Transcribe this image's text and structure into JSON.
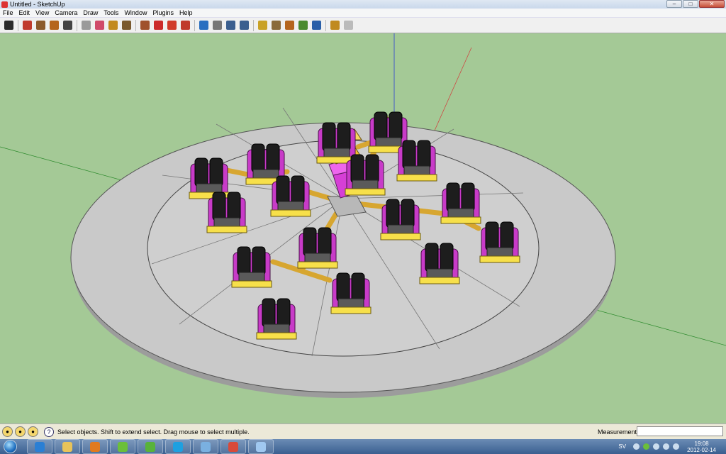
{
  "window": {
    "title": "Untitled - SketchUp"
  },
  "menu": [
    "File",
    "Edit",
    "View",
    "Camera",
    "Draw",
    "Tools",
    "Window",
    "Plugins",
    "Help"
  ],
  "window_controls": [
    "minimize",
    "maximize",
    "close"
  ],
  "toolbar": [
    {
      "name": "select-tool",
      "icon": "arrow-cursor-icon",
      "color": "#2a2a2a"
    },
    {
      "sep": true
    },
    {
      "name": "line-tool",
      "icon": "pencil-icon",
      "color": "#c0392b"
    },
    {
      "name": "rectangle-tool",
      "icon": "rectangle-icon",
      "color": "#8b5a2b"
    },
    {
      "name": "circle-tool",
      "icon": "circle-icon",
      "color": "#b5651d"
    },
    {
      "name": "arc-tool",
      "icon": "arc-icon",
      "color": "#444444"
    },
    {
      "sep": true
    },
    {
      "name": "make-component-tool",
      "icon": "component-icon",
      "color": "#9a9a9a"
    },
    {
      "name": "eraser-tool",
      "icon": "eraser-icon",
      "color": "#d04a6a"
    },
    {
      "name": "tape-measure-tool",
      "icon": "tape-measure-icon",
      "color": "#c28a1e"
    },
    {
      "name": "paint-bucket-tool",
      "icon": "paint-bucket-icon",
      "color": "#7a5a2e"
    },
    {
      "sep": true
    },
    {
      "name": "push-pull-tool",
      "icon": "push-pull-icon",
      "color": "#a0522d"
    },
    {
      "name": "move-tool",
      "icon": "move-icon",
      "color": "#cc2a2a"
    },
    {
      "name": "rotate-tool",
      "icon": "rotate-icon",
      "color": "#d03a2a"
    },
    {
      "name": "follow-me-tool",
      "icon": "follow-me-icon",
      "color": "#c0392b"
    },
    {
      "sep": true
    },
    {
      "name": "orbit-tool",
      "icon": "orbit-icon",
      "color": "#2a6fc0"
    },
    {
      "name": "pan-tool",
      "icon": "hand-icon",
      "color": "#777777"
    },
    {
      "name": "zoom-tool",
      "icon": "magnifier-icon",
      "color": "#3b5f8f"
    },
    {
      "name": "zoom-extents-tool",
      "icon": "zoom-extents-icon",
      "color": "#3b5f8f"
    },
    {
      "sep": true
    },
    {
      "name": "get-models-tool",
      "icon": "get-models-icon",
      "color": "#c9a227"
    },
    {
      "name": "share-model-tool",
      "icon": "share-model-icon",
      "color": "#8a6a3a"
    },
    {
      "name": "share-component-tool",
      "icon": "share-component-icon",
      "color": "#b5651d"
    },
    {
      "name": "place-model-tool",
      "icon": "place-model-icon",
      "color": "#4a8a2e"
    },
    {
      "name": "google-earth-tool",
      "icon": "globe-icon",
      "color": "#2a5fa8"
    },
    {
      "sep": true
    },
    {
      "name": "extension-tool",
      "icon": "extension-icon",
      "color": "#c08a20"
    },
    {
      "name": "dynamic-component-tool",
      "icon": "dynamic-component-icon",
      "color": "#bbbbbb"
    }
  ],
  "status": {
    "text": "Select objects. Shift to extend select. Drag mouse to select multiple.",
    "measurements_label": "Measurements",
    "measurements_value": ""
  },
  "taskbar": {
    "apps": [
      {
        "name": "ie",
        "icon": "internet-explorer-icon",
        "color": "#2a7fd4"
      },
      {
        "name": "explorer",
        "icon": "folder-icon",
        "color": "#e8c35a"
      },
      {
        "name": "media-player",
        "icon": "media-player-icon",
        "color": "#e07a1f"
      },
      {
        "name": "spotify",
        "icon": "spotify-icon",
        "color": "#6bbf3a"
      },
      {
        "name": "utorrent",
        "icon": "utorrent-icon",
        "color": "#58b33a"
      },
      {
        "name": "skype",
        "icon": "skype-icon",
        "color": "#1ea0e0"
      },
      {
        "name": "control-panel",
        "icon": "control-panel-icon",
        "color": "#7ab0e0"
      },
      {
        "name": "sketchup",
        "icon": "sketchup-icon",
        "color": "#d84a3a"
      },
      {
        "name": "paint",
        "icon": "paint-icon",
        "color": "#a0c8f0"
      }
    ],
    "language": "SV",
    "time": "19:08",
    "date": "2012-02-14"
  }
}
